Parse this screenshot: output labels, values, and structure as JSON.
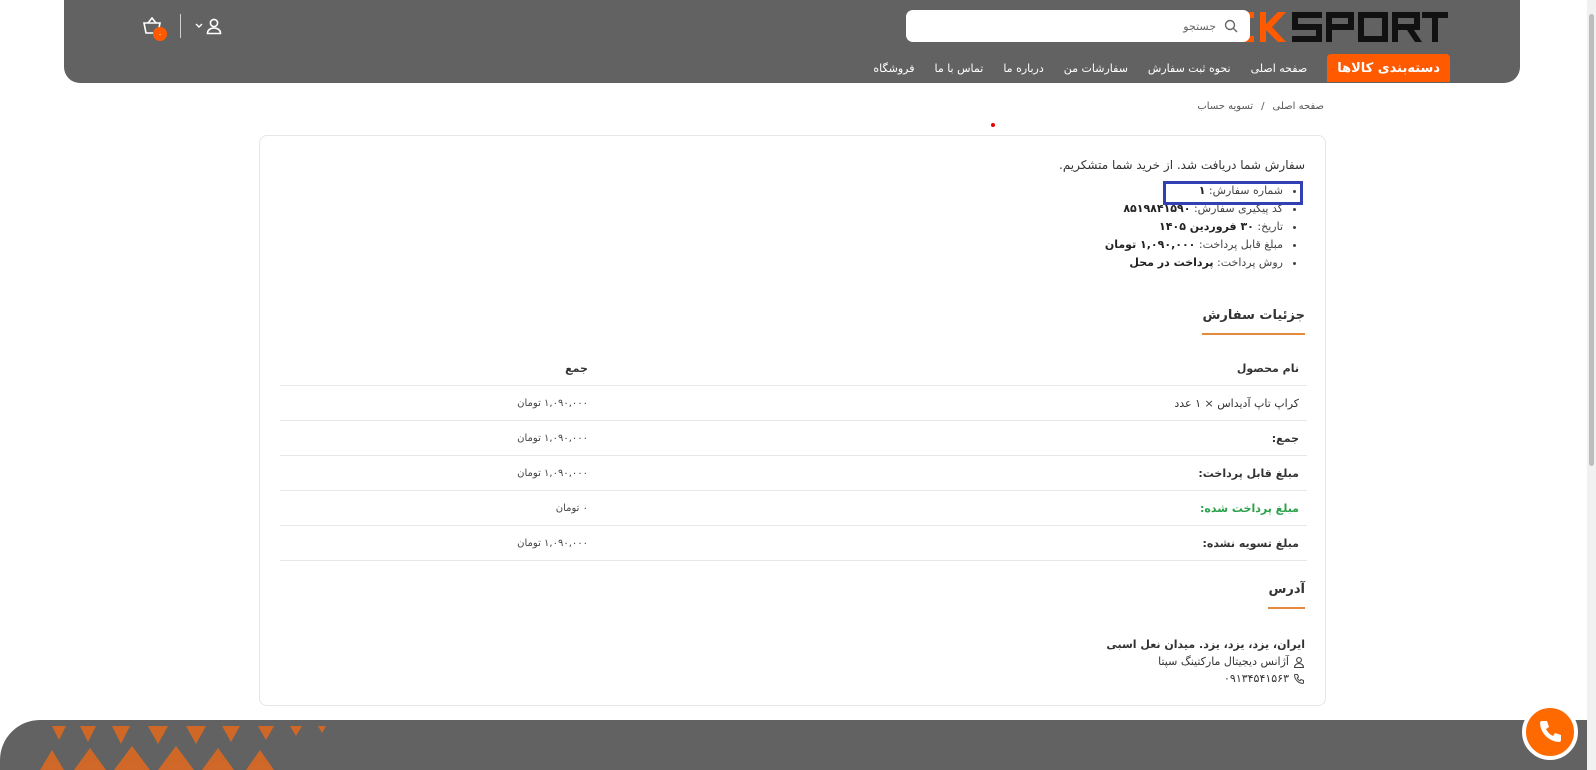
{
  "header": {
    "logo_text": "ZEKSPORT",
    "search": {
      "placeholder": "جستجو"
    },
    "cart_count": "۰",
    "nav": {
      "category_label": "دسته‌بندی کالاها",
      "items": [
        "صفحه اصلی",
        "نحوه ثبت سفارش",
        "سفارشات من",
        "درباره ما",
        "تماس با ما",
        "فروشگاه"
      ]
    }
  },
  "breadcrumb": {
    "home": "صفحه اصلی",
    "separator": "/",
    "current": "تسویه حساب"
  },
  "order": {
    "thanks": "سفارش شما دریافت شد. از خرید شما متشکریم.",
    "number_label": "شماره سفارش:",
    "number_value": "۱",
    "tracking_label": "کد پیگیری سفارش:",
    "tracking_value": "۸۵۱۹۸۴۱۵۹۰",
    "date_label": "تاریخ:",
    "date_value": "۳۰ فروردین ۱۴۰۵",
    "payable_label": "مبلغ قابل پرداخت:",
    "payable_value": "۱,۰۹۰,۰۰۰ تومان",
    "method_label": "روش پرداخت:",
    "method_value": "پرداخت در محل"
  },
  "details": {
    "title": "جزئیات سفارش",
    "col_product": "نام محصول",
    "col_total": "جمع",
    "product_name": "کراپ تاپ آدیداس × ۱ عدد",
    "product_total": "۱,۰۹۰,۰۰۰ تومان",
    "subtotal_label": "جمع:",
    "subtotal_value": "۱,۰۹۰,۰۰۰ تومان",
    "payable_label": "مبلغ قابل پرداخت:",
    "payable_value": "۱,۰۹۰,۰۰۰ تومان",
    "paid_label": "مبلغ پرداخت شده:",
    "paid_value": "۰ تومان",
    "unsettled_label": "مبلغ تسویه نشده:",
    "unsettled_value": "۱,۰۹۰,۰۰۰ تومان"
  },
  "address": {
    "title": "آدرس",
    "line": "ایران، یزد، یزد، یزد. میدان نعل اسبی",
    "company": "آژانس دیجیتال مارکتینگ سپتا",
    "phone": "۰۹۱۳۴۵۴۱۵۶۳"
  },
  "colors": {
    "accent": "#ff5a00",
    "header_bg": "#626262",
    "highlight": "#3340b4",
    "paid_green": "#2aa14a"
  }
}
